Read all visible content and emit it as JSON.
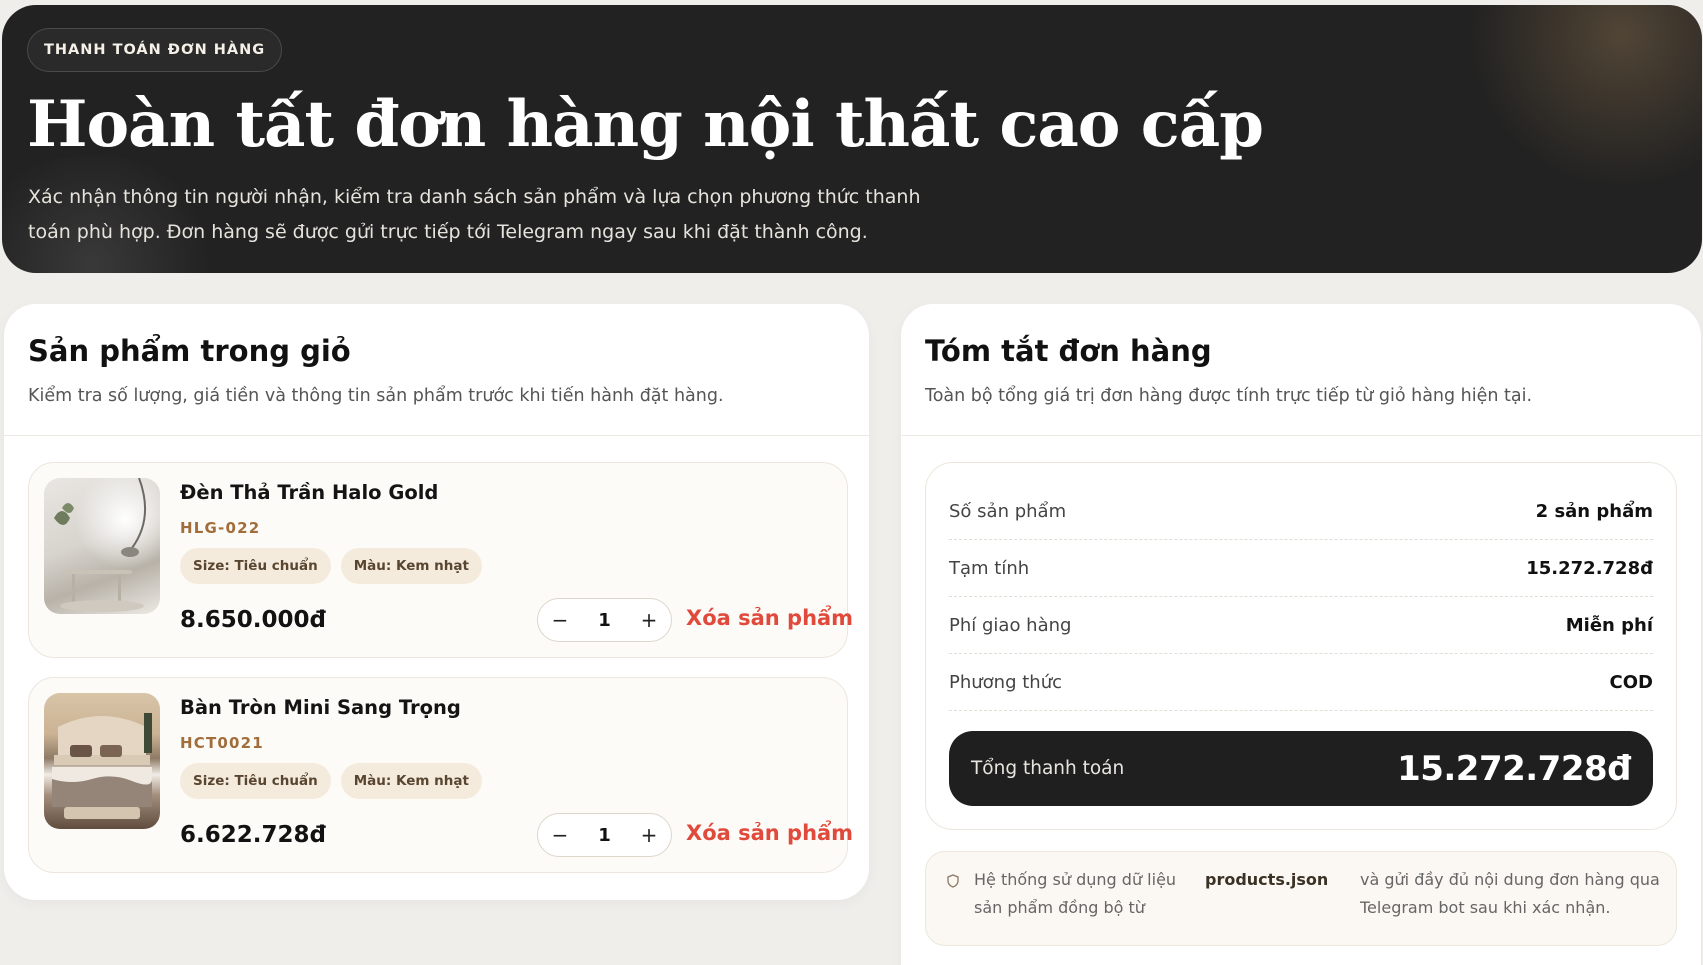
{
  "hero": {
    "badge": "THANH TOÁN ĐƠN HÀNG",
    "title": "Hoàn tất đơn hàng nội thất cao cấp",
    "description": "Xác nhận thông tin người nhận, kiểm tra danh sách sản phẩm và lựa chọn phương thức thanh toán phù hợp. Đơn hàng sẽ được gửi trực tiếp tới Telegram ngay sau khi đặt thành công."
  },
  "cart": {
    "title": "Sản phẩm trong giỏ",
    "subtitle": "Kiểm tra số lượng, giá tiền và thông tin sản phẩm trước khi tiến hành đặt hàng.",
    "items": [
      {
        "name": "Đèn Thả Trần Halo Gold",
        "sku": "HLG-022",
        "size": "Size: Tiêu chuẩn",
        "color": "Màu: Kem nhạt",
        "price": "8.650.000đ",
        "qty": "1",
        "minus": "−",
        "plus": "+",
        "remove": "Xóa sản phẩm",
        "image_icon": "pendant-lamp-photo"
      },
      {
        "name": "Bàn Tròn Mini Sang Trọng",
        "sku": "HCT0021",
        "size": "Size: Tiêu chuẩn",
        "color": "Màu: Kem nhạt",
        "price": "6.622.728đ",
        "qty": "1",
        "minus": "−",
        "plus": "+",
        "remove": "Xóa sản phẩm",
        "image_icon": "bedroom-photo"
      }
    ]
  },
  "summary": {
    "title": "Tóm tắt đơn hàng",
    "subtitle": "Toàn bộ tổng giá trị đơn hàng được tính trực tiếp từ giỏ hàng hiện tại.",
    "rows": [
      {
        "label": "Số sản phẩm",
        "value": "2 sản phẩm"
      },
      {
        "label": "Tạm tính",
        "value": "15.272.728đ"
      },
      {
        "label": "Phí giao hàng",
        "value": "Miễn phí"
      },
      {
        "label": "Phương thức",
        "value": "COD"
      }
    ],
    "total_label": "Tổng thanh toán",
    "total_value": "15.272.728đ"
  },
  "note": {
    "icon": "shield-icon",
    "text_before": "Hệ thống sử dụng dữ liệu sản phẩm đồng bộ từ",
    "file": "products.json",
    "text_after": "và gửi đầy đủ nội dung đơn hàng qua Telegram bot sau khi xác nhận."
  },
  "colors": {
    "hero_bg": "#222222",
    "accent_sku": "#a06d3b",
    "remove": "#e04a3c",
    "total_bg": "#1f1f1f",
    "page_bg": "#f0eeeb"
  }
}
